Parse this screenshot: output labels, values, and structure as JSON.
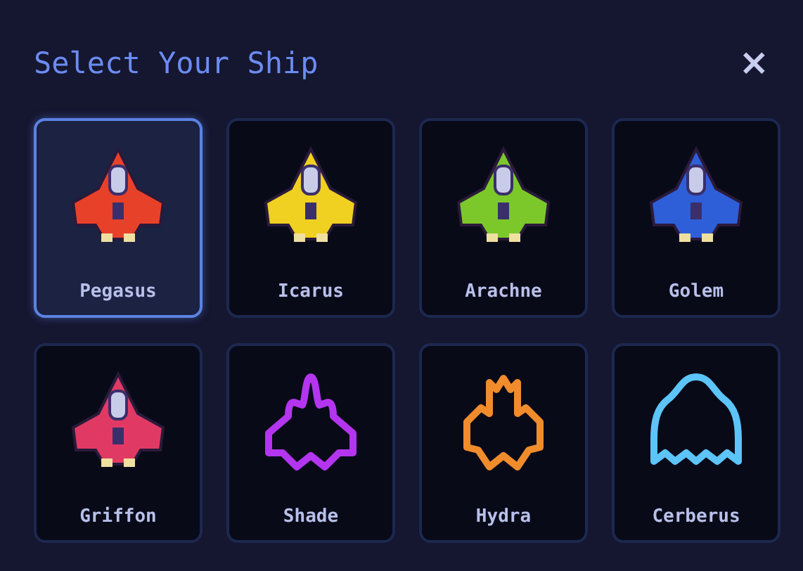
{
  "dialog": {
    "title": "Select Your Ship",
    "close": "×"
  },
  "ships": [
    {
      "name": "Pegasus",
      "kind": "sprite",
      "color": "#e8412a",
      "selected": true
    },
    {
      "name": "Icarus",
      "kind": "sprite",
      "color": "#f0d020",
      "selected": false
    },
    {
      "name": "Arachne",
      "kind": "sprite",
      "color": "#7cc82a",
      "selected": false
    },
    {
      "name": "Golem",
      "kind": "sprite",
      "color": "#2f5fd8",
      "selected": false
    },
    {
      "name": "Griffon",
      "kind": "sprite",
      "color": "#e03a64",
      "selected": false
    },
    {
      "name": "Shade",
      "kind": "dart",
      "color": "#b435f0",
      "selected": false
    },
    {
      "name": "Hydra",
      "kind": "crown",
      "color": "#f08c2c",
      "selected": false
    },
    {
      "name": "Cerberus",
      "kind": "bell",
      "color": "#5cc4f8",
      "selected": false
    }
  ]
}
